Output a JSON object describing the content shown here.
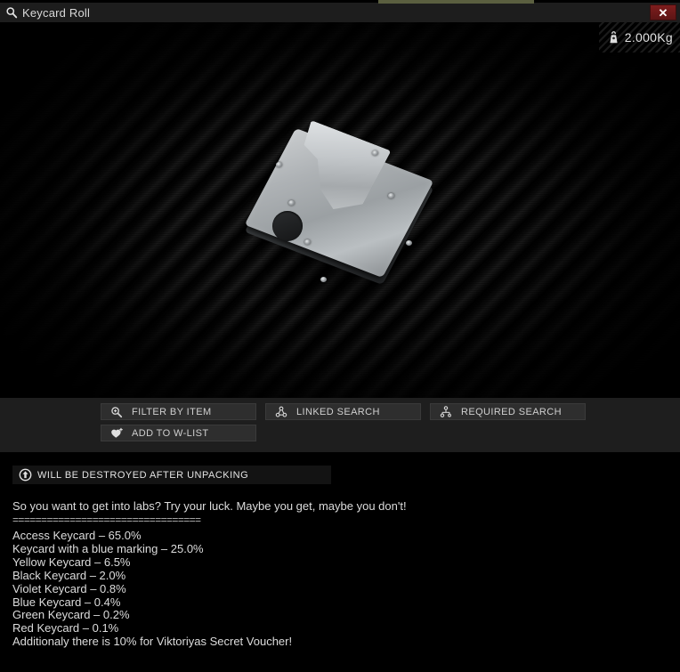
{
  "window": {
    "title": "Keycard Roll",
    "title_icon": "magnifier-icon",
    "close_label": "✕"
  },
  "item": {
    "weight": "2.000Kg",
    "weight_icon": "weight-kettlebell-icon",
    "artwork_name": "metal-card-holder-wallet"
  },
  "actions": {
    "buttons": [
      {
        "label": "FILTER BY ITEM",
        "icon": "magnifier-plus-icon",
        "name": "filter-by-item-button"
      },
      {
        "label": "LINKED SEARCH",
        "icon": "linked-nodes-icon",
        "name": "linked-search-button"
      },
      {
        "label": "REQUIRED SEARCH",
        "icon": "required-nodes-icon",
        "name": "required-search-button"
      },
      {
        "label": "ADD TO W-LIST",
        "icon": "heart-plus-icon",
        "name": "add-to-wishlist-button"
      }
    ]
  },
  "notice": {
    "icon": "unpack-arrow-icon",
    "label": "WILL BE DESTROYED AFTER UNPACKING"
  },
  "description": {
    "intro": "So you want to get into labs? Try your luck. Maybe you get, maybe you don't!",
    "separator": "=================================",
    "loot_table": [
      "Access Keycard – 65.0%",
      "Keycard with a blue marking – 25.0%",
      "Yellow Keycard – 6.5%",
      "Black Keycard – 2.0%",
      "Violet Keycard – 0.8%",
      "Blue Keycard – 0.4%",
      "Green Keycard – 0.2%",
      "Red Keycard – 0.1%"
    ],
    "footer": "Additionaly there is 10% for Viktoriyas Secret Voucher!"
  },
  "colors": {
    "accent_strip": "#5b5f40",
    "close_red": "#7e1d1d",
    "panel_bg": "#1e1e1e",
    "text": "#dcdcdc"
  }
}
